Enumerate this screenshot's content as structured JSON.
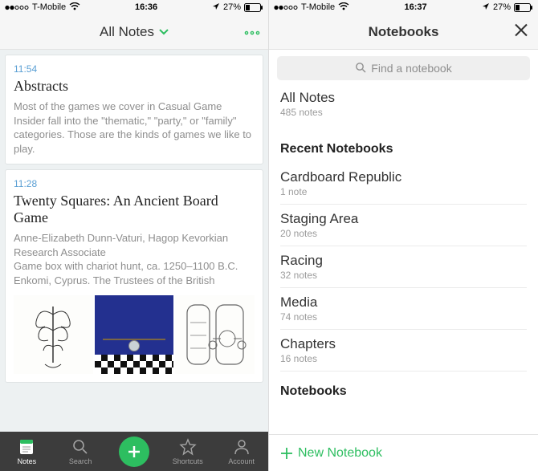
{
  "status": {
    "carrier": "T-Mobile",
    "wifi_icon": "wifi-icon",
    "location_icon": "location-arrow-icon",
    "battery_pct": "27%",
    "time_left": "16:36",
    "time_right": "16:37"
  },
  "colors": {
    "accent_green": "#2dbe60"
  },
  "left": {
    "title": "All Notes",
    "notes": [
      {
        "time": "11:54",
        "title": "Abstracts",
        "body": "Most of the games we cover in Casual Game Insider fall into the \"thematic,\" \"party,\" or \"family\" categories. Those are the kinds of games we like to play."
      },
      {
        "time": "11:28",
        "title": "Twenty Squares: An Ancient Board Game",
        "body": "Anne-Elizabeth Dunn-Vaturi, Hagop Kevorkian Research Associate\nGame box with chariot hunt, ca. 1250–1100 B.C. Enkomi, Cyprus. The Trustees of the British"
      }
    ],
    "tabs": [
      {
        "label": "Notes",
        "icon": "notes-icon"
      },
      {
        "label": "Search",
        "icon": "search-icon"
      },
      {
        "label": "",
        "icon": "plus-icon"
      },
      {
        "label": "Shortcuts",
        "icon": "star-icon"
      },
      {
        "label": "Account",
        "icon": "account-icon"
      }
    ]
  },
  "right": {
    "title": "Notebooks",
    "search_placeholder": "Find a notebook",
    "all_notes": {
      "label": "All Notes",
      "sub": "485 notes"
    },
    "section_recent": "Recent Notebooks",
    "recent": [
      {
        "label": "Cardboard Republic",
        "sub": "1 note"
      },
      {
        "label": "Staging Area",
        "sub": "20 notes"
      },
      {
        "label": "Racing",
        "sub": "32 notes"
      },
      {
        "label": "Media",
        "sub": "74 notes"
      },
      {
        "label": "Chapters",
        "sub": "16 notes"
      }
    ],
    "section_notebooks": "Notebooks",
    "new_notebook_label": "New Notebook"
  }
}
